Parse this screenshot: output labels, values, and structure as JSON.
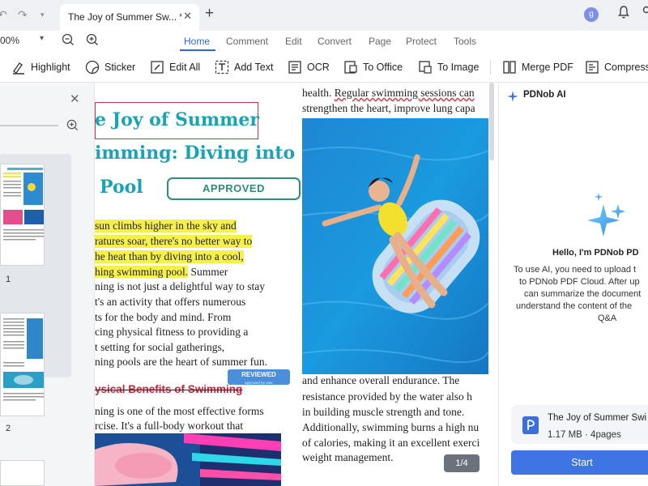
{
  "tabbar": {
    "doc_tab_title": "The Joy of Summer Sw... *",
    "avatar_letter": "g"
  },
  "menu": {
    "zoom": "00%",
    "items": [
      "Home",
      "Comment",
      "Edit",
      "Convert",
      "Page",
      "Protect",
      "Tools"
    ]
  },
  "toolbar": {
    "tools": [
      "Highlight",
      "Sticker",
      "Edit All",
      "Add Text",
      "OCR",
      "To Office",
      "To Image",
      "Merge PDF",
      "Compress"
    ]
  },
  "thumbnails": {
    "pages": [
      "1",
      "2"
    ]
  },
  "document": {
    "title_lines": [
      "e Joy of Summer",
      "imming: Diving into",
      "Pool"
    ],
    "stamp_approved": "APPROVED",
    "highlighted_lines": [
      "sun climbs higher in the sky and",
      "ratures soar, there's no better way to",
      "he heat than by diving into a cool,",
      "hing swimming pool."
    ],
    "body_cont_line4": " Summer",
    "body_lines": [
      "ning is not just a delightful way to stay",
      "t's an activity that offers numerous",
      "ts for the body and mind. From",
      "cing physical fitness to providing a",
      "t setting for social gatherings,",
      "ning pools are the heart of summer fun."
    ],
    "stamp_reviewed": "REVIEWED",
    "stamp_reviewed_sub": "approved by user",
    "section_heading": "ysical Benefits of Swimming",
    "section_lines": [
      "ning is one of the most effective forms",
      "rcise. It's a full-body workout that"
    ],
    "col2_top_prefix": "health. ",
    "col2_top_underlined": "Regular swimming sessions can",
    "col2_line2": "strengthen the heart, improve lung capa",
    "col2_lines": [
      "and enhance overall endurance. The",
      "resistance provided by the water also h",
      "in building muscle strength and tone.",
      "Additionally, swimming burns a high nu",
      "of calories, making it an excellent exerci",
      "weight management."
    ],
    "page_indicator": "1/4"
  },
  "ai_panel": {
    "title": "PDNob AI",
    "greeting": "Hello, I'm PDNob PD",
    "description": [
      "To use AI, you need to upload t",
      "to PDNob PDF Cloud. After up",
      "can summarize the document",
      "understand the content of the",
      "Q&A"
    ],
    "file_name": "The Joy of Summer Swi",
    "file_meta": "1.17 MB · 4pages",
    "start_label": "Start"
  },
  "colors": {
    "accent": "#2f66e8",
    "title_teal": "#1aa2b5",
    "approved_green": "#2f8c7a",
    "highlight": "#f6f04a",
    "reviewed_blue": "#4b8fd8",
    "heading_red": "#c02a37"
  },
  "icons": [
    "undo-icon",
    "redo-icon",
    "close-icon",
    "plus-icon",
    "bell-icon",
    "zoom-out-icon",
    "zoom-in-icon",
    "highlight-icon",
    "sticker-icon",
    "edit-all-icon",
    "add-text-icon",
    "ocr-icon",
    "to-office-icon",
    "to-image-icon",
    "merge-pdf-icon",
    "compress-icon",
    "ai-sparkle-icon",
    "pdf-file-icon"
  ]
}
